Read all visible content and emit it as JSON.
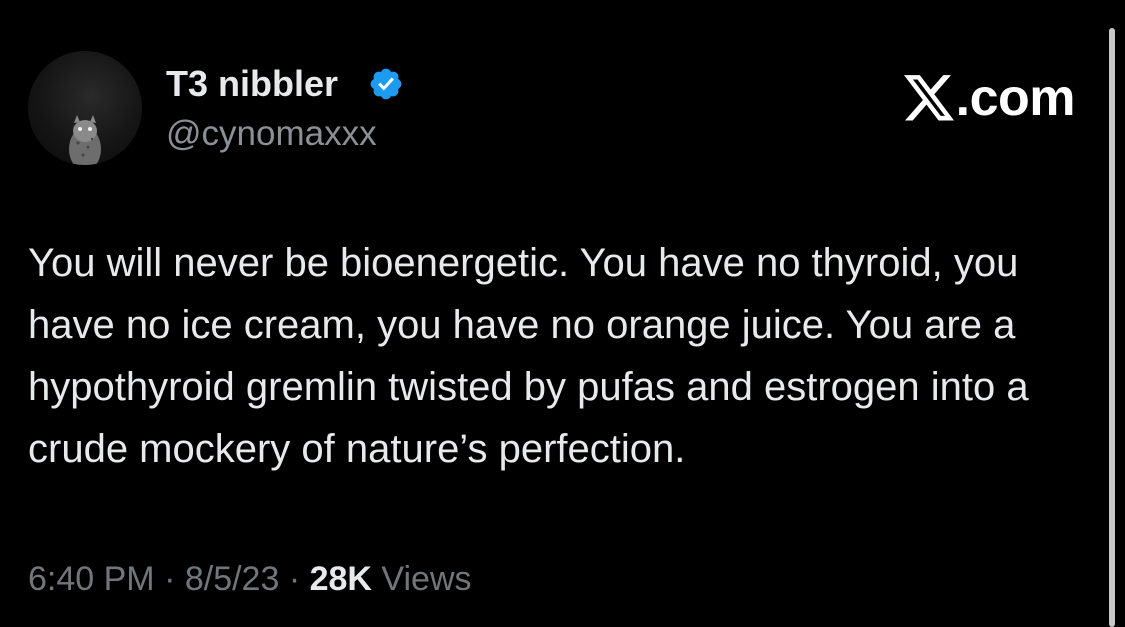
{
  "author": {
    "display_name": "T3 nibbler",
    "handle": "@cynomaxxx",
    "verified": true,
    "verified_color": "#1d9bf0",
    "avatar_icon": "snow-leopard-avatar"
  },
  "brand": {
    "text": ".com",
    "icon": "x-logo-icon"
  },
  "tweet": {
    "text": "You will never be bioenergetic. You have no thyroid, you have no ice cream, you have no orange juice. You are a hypothyroid gremlin twisted by pufas and estrogen into a crude mockery of nature’s perfection."
  },
  "meta": {
    "time": "6:40 PM",
    "separator": " · ",
    "date": "8/5/23",
    "views_count": "28K",
    "views_label": " Views"
  },
  "colors": {
    "background": "#000000",
    "text": "#e7e9ea",
    "muted": "#71767b"
  }
}
